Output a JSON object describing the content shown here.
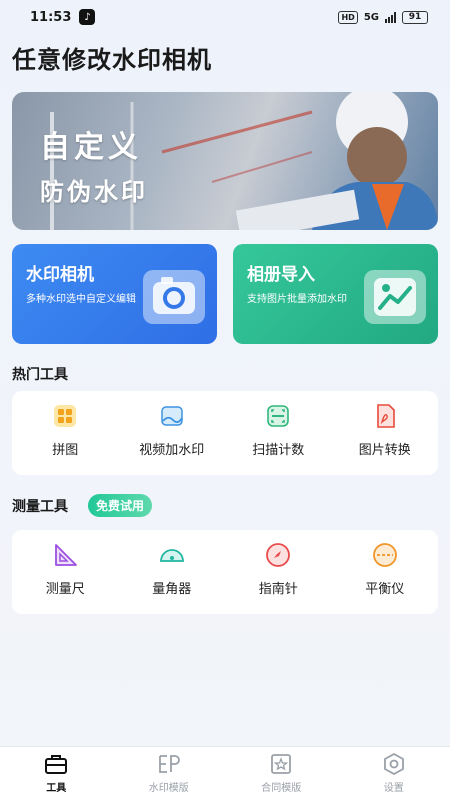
{
  "status_bar": {
    "time": "11:53",
    "network": "5G",
    "battery": "91"
  },
  "page": {
    "title": "任意修改水印相机"
  },
  "banner": {
    "line1": "自定义",
    "line2": "防伪水印"
  },
  "cards": [
    {
      "title": "水印相机",
      "desc": "多种水印选中自定义编辑",
      "color": "#3d8bf2"
    },
    {
      "title": "相册导入",
      "desc": "支持图片批量添加水印",
      "color": "#35c79a"
    }
  ],
  "hot_tools": {
    "title": "热门工具",
    "items": [
      {
        "label": "拼图",
        "icon": "puzzle-icon"
      },
      {
        "label": "视频加水印",
        "icon": "video-watermark-icon"
      },
      {
        "label": "扫描计数",
        "icon": "scan-icon"
      },
      {
        "label": "图片转换",
        "icon": "pdf-icon"
      }
    ]
  },
  "measure_tools": {
    "title": "测量工具",
    "badge": "免费试用",
    "items": [
      {
        "label": "测量尺",
        "icon": "triangle-ruler-icon"
      },
      {
        "label": "量角器",
        "icon": "protractor-icon"
      },
      {
        "label": "指南针",
        "icon": "compass-icon"
      },
      {
        "label": "平衡仪",
        "icon": "level-icon"
      }
    ]
  },
  "tabs": [
    {
      "label": "工具",
      "icon": "toolbox-icon",
      "active": true
    },
    {
      "label": "水印模版",
      "icon": "watermark-template-icon",
      "active": false
    },
    {
      "label": "合同模版",
      "icon": "contract-template-icon",
      "active": false
    },
    {
      "label": "设置",
      "icon": "settings-icon",
      "active": false
    }
  ]
}
